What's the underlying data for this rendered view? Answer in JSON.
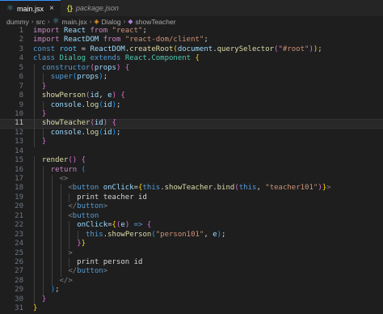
{
  "tabs": [
    {
      "name": "main.jsx",
      "icon": "react-icon",
      "active": true,
      "close": "×"
    },
    {
      "name": "package.json",
      "icon": "json-icon",
      "active": false
    }
  ],
  "breadcrumb": {
    "parts": [
      "dummy",
      "src",
      "main.jsx",
      "Dialog",
      "showTeacher"
    ],
    "sep": "›"
  },
  "editor": {
    "current_line": 11,
    "lines": [
      [
        [
          "kw2",
          "import "
        ],
        [
          "var",
          "React "
        ],
        [
          "kw2",
          "from "
        ],
        [
          "str",
          "\"react\""
        ],
        [
          "txt",
          ";"
        ]
      ],
      [
        [
          "kw2",
          "import "
        ],
        [
          "var",
          "ReactDOM "
        ],
        [
          "kw2",
          "from "
        ],
        [
          "str",
          "\"react-dom/client\""
        ],
        [
          "txt",
          ";"
        ]
      ],
      [
        [
          "kw",
          "const "
        ],
        [
          "cst",
          "root "
        ],
        [
          "txt",
          "= "
        ],
        [
          "var",
          "ReactDOM"
        ],
        [
          "txt",
          "."
        ],
        [
          "fn",
          "createRoot"
        ],
        [
          "b1",
          "("
        ],
        [
          "var",
          "document"
        ],
        [
          "txt",
          "."
        ],
        [
          "fn",
          "querySelector"
        ],
        [
          "b2",
          "("
        ],
        [
          "str",
          "\"#root\""
        ],
        [
          "b2",
          ")"
        ],
        [
          "b1",
          ")"
        ],
        [
          "txt",
          ";"
        ]
      ],
      [
        [
          "kw",
          "class "
        ],
        [
          "cls",
          "Dialog "
        ],
        [
          "kw",
          "extends "
        ],
        [
          "cls",
          "React"
        ],
        [
          "txt",
          "."
        ],
        [
          "cls",
          "Component "
        ],
        [
          "b1",
          "{"
        ]
      ],
      [
        [
          "txt",
          "  "
        ],
        [
          "kw",
          "constructor"
        ],
        [
          "b2",
          "("
        ],
        [
          "var",
          "props"
        ],
        [
          "b2",
          ") "
        ],
        [
          "b2",
          "{"
        ]
      ],
      [
        [
          "txt",
          "    "
        ],
        [
          "kw",
          "super"
        ],
        [
          "b3",
          "("
        ],
        [
          "var",
          "props"
        ],
        [
          "b3",
          ")"
        ],
        [
          "txt",
          ";"
        ]
      ],
      [
        [
          "txt",
          "  "
        ],
        [
          "b2",
          "}"
        ]
      ],
      [
        [
          "txt",
          "  "
        ],
        [
          "fn",
          "showPerson"
        ],
        [
          "b2",
          "("
        ],
        [
          "var",
          "id"
        ],
        [
          "txt",
          ", "
        ],
        [
          "var",
          "e"
        ],
        [
          "b2",
          ") "
        ],
        [
          "b2",
          "{"
        ]
      ],
      [
        [
          "txt",
          "    "
        ],
        [
          "var",
          "console"
        ],
        [
          "txt",
          "."
        ],
        [
          "fn",
          "log"
        ],
        [
          "b3",
          "("
        ],
        [
          "var",
          "id"
        ],
        [
          "b3",
          ")"
        ],
        [
          "txt",
          ";"
        ]
      ],
      [
        [
          "txt",
          "  "
        ],
        [
          "b2",
          "}"
        ]
      ],
      [
        [
          "txt",
          "  "
        ],
        [
          "fn",
          "showTeacher"
        ],
        [
          "b2",
          "("
        ],
        [
          "var",
          "id"
        ],
        [
          "b2",
          ") "
        ],
        [
          "b2",
          "{"
        ]
      ],
      [
        [
          "txt",
          "    "
        ],
        [
          "var",
          "console"
        ],
        [
          "txt",
          "."
        ],
        [
          "fn",
          "log"
        ],
        [
          "b3",
          "("
        ],
        [
          "var",
          "id"
        ],
        [
          "b3",
          ")"
        ],
        [
          "txt",
          ";"
        ]
      ],
      [
        [
          "txt",
          "  "
        ],
        [
          "b2",
          "}"
        ]
      ],
      [
        [
          "txt",
          ""
        ]
      ],
      [
        [
          "txt",
          "  "
        ],
        [
          "fn",
          "render"
        ],
        [
          "b2",
          "() "
        ],
        [
          "b2",
          "{"
        ]
      ],
      [
        [
          "txt",
          "    "
        ],
        [
          "kw2",
          "return "
        ],
        [
          "b3",
          "("
        ]
      ],
      [
        [
          "txt",
          "      "
        ],
        [
          "ang",
          "<>"
        ]
      ],
      [
        [
          "txt",
          "        "
        ],
        [
          "ang",
          "<"
        ],
        [
          "tag",
          "button "
        ],
        [
          "var",
          "onClick"
        ],
        [
          "txt",
          "="
        ],
        [
          "b1",
          "{"
        ],
        [
          "kw",
          "this"
        ],
        [
          "txt",
          "."
        ],
        [
          "fn",
          "showTeacher"
        ],
        [
          "txt",
          "."
        ],
        [
          "fn",
          "bind"
        ],
        [
          "b2",
          "("
        ],
        [
          "kw",
          "this"
        ],
        [
          "txt",
          ", "
        ],
        [
          "str",
          "\"teacher101\""
        ],
        [
          "b2",
          ")"
        ],
        [
          "b1",
          "}"
        ],
        [
          "ang",
          ">"
        ]
      ],
      [
        [
          "txt",
          "          print teacher id"
        ]
      ],
      [
        [
          "txt",
          "        "
        ],
        [
          "ang",
          "</"
        ],
        [
          "tag",
          "button"
        ],
        [
          "ang",
          ">"
        ]
      ],
      [
        [
          "txt",
          "        "
        ],
        [
          "ang",
          "<"
        ],
        [
          "tag",
          "button"
        ]
      ],
      [
        [
          "txt",
          "          "
        ],
        [
          "var",
          "onClick"
        ],
        [
          "txt",
          "="
        ],
        [
          "b1",
          "{"
        ],
        [
          "b2",
          "("
        ],
        [
          "var",
          "e"
        ],
        [
          "b2",
          ") "
        ],
        [
          "kw",
          "=> "
        ],
        [
          "b2",
          "{"
        ]
      ],
      [
        [
          "txt",
          "            "
        ],
        [
          "kw",
          "this"
        ],
        [
          "txt",
          "."
        ],
        [
          "fn",
          "showPerson"
        ],
        [
          "b3",
          "("
        ],
        [
          "str",
          "\"person101\""
        ],
        [
          "txt",
          ", "
        ],
        [
          "var",
          "e"
        ],
        [
          "b3",
          ")"
        ],
        [
          "txt",
          ";"
        ]
      ],
      [
        [
          "txt",
          "          "
        ],
        [
          "b2",
          "}"
        ],
        [
          "b1",
          "}"
        ]
      ],
      [
        [
          "txt",
          "        "
        ],
        [
          "ang",
          ">"
        ]
      ],
      [
        [
          "txt",
          "          print person id"
        ]
      ],
      [
        [
          "txt",
          "        "
        ],
        [
          "ang",
          "</"
        ],
        [
          "tag",
          "button"
        ],
        [
          "ang",
          ">"
        ]
      ],
      [
        [
          "txt",
          "      "
        ],
        [
          "ang",
          "</>"
        ]
      ],
      [
        [
          "txt",
          "    "
        ],
        [
          "b3",
          ")"
        ],
        [
          "txt",
          ";"
        ]
      ],
      [
        [
          "txt",
          "  "
        ],
        [
          "b2",
          "}"
        ]
      ],
      [
        [
          "b1",
          "}"
        ]
      ]
    ]
  }
}
